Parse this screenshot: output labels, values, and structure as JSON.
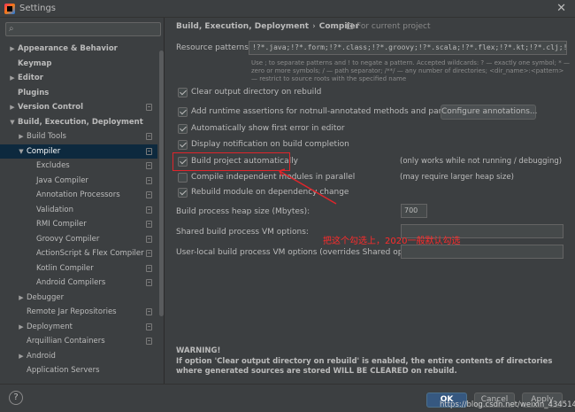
{
  "window": {
    "title": "Settings"
  },
  "search": {
    "placeholder": ""
  },
  "tree": [
    {
      "label": "Appearance & Behavior",
      "bold": true,
      "arrow": "right",
      "indent": 0
    },
    {
      "label": "Keymap",
      "bold": true,
      "arrow": "",
      "indent": 0
    },
    {
      "label": "Editor",
      "bold": true,
      "arrow": "right",
      "indent": 0
    },
    {
      "label": "Plugins",
      "bold": true,
      "arrow": "",
      "indent": 0
    },
    {
      "label": "Version Control",
      "bold": true,
      "arrow": "right",
      "indent": 0,
      "cfg": true
    },
    {
      "label": "Build, Execution, Deployment",
      "bold": true,
      "arrow": "down",
      "indent": 0
    },
    {
      "label": "Build Tools",
      "bold": false,
      "arrow": "right",
      "indent": 1,
      "cfg": true
    },
    {
      "label": "Compiler",
      "bold": false,
      "arrow": "down",
      "indent": 1,
      "cfg": true,
      "selected": true
    },
    {
      "label": "Excludes",
      "bold": false,
      "arrow": "",
      "indent": 2,
      "cfg": true
    },
    {
      "label": "Java Compiler",
      "bold": false,
      "arrow": "",
      "indent": 2,
      "cfg": true
    },
    {
      "label": "Annotation Processors",
      "bold": false,
      "arrow": "",
      "indent": 2,
      "cfg": true
    },
    {
      "label": "Validation",
      "bold": false,
      "arrow": "",
      "indent": 2,
      "cfg": true
    },
    {
      "label": "RMI Compiler",
      "bold": false,
      "arrow": "",
      "indent": 2,
      "cfg": true
    },
    {
      "label": "Groovy Compiler",
      "bold": false,
      "arrow": "",
      "indent": 2,
      "cfg": true
    },
    {
      "label": "ActionScript & Flex Compiler",
      "bold": false,
      "arrow": "",
      "indent": 2,
      "cfg": true
    },
    {
      "label": "Kotlin Compiler",
      "bold": false,
      "arrow": "",
      "indent": 2,
      "cfg": true
    },
    {
      "label": "Android Compilers",
      "bold": false,
      "arrow": "",
      "indent": 2,
      "cfg": true
    },
    {
      "label": "Debugger",
      "bold": false,
      "arrow": "right",
      "indent": 1
    },
    {
      "label": "Remote Jar Repositories",
      "bold": false,
      "arrow": "",
      "indent": 1,
      "cfg": true
    },
    {
      "label": "Deployment",
      "bold": false,
      "arrow": "right",
      "indent": 1,
      "cfg": true
    },
    {
      "label": "Arquillian Containers",
      "bold": false,
      "arrow": "",
      "indent": 1,
      "cfg": true
    },
    {
      "label": "Android",
      "bold": false,
      "arrow": "right",
      "indent": 1
    },
    {
      "label": "Application Servers",
      "bold": false,
      "arrow": "",
      "indent": 1
    }
  ],
  "breadcrumb": {
    "parent": "Build, Execution, Deployment",
    "separator": "›",
    "current": "Compiler",
    "scope": "For current project"
  },
  "resource_patterns": {
    "label": "Resource patterns:",
    "value": "!?*.java;!?*.form;!?*.class;!?*.groovy;!?*.scala;!?*.flex;!?*.kt;!?*.clj;!?*.aj",
    "hint": "Use ; to separate patterns and ! to negate a pattern. Accepted wildcards: ? — exactly one symbol; * — zero or more symbols; / — path separator; /**/ — any number of directories; <dir_name>:<pattern> — restrict to source roots with the specified name"
  },
  "options": {
    "clear_output": {
      "label": "Clear output directory on rebuild",
      "checked": true
    },
    "runtime_assertions": {
      "label": "Add runtime assertions for notnull-annotated methods and parameters",
      "checked": true
    },
    "configure_annotations": "Configure annotations...",
    "show_first_error": {
      "label": "Automatically show first error in editor",
      "checked": true
    },
    "display_notification": {
      "label": "Display notification on build completion",
      "checked": true
    },
    "build_automatically": {
      "label": "Build project automatically",
      "checked": true,
      "note": "(only works while not running / debugging)"
    },
    "compile_parallel": {
      "label": "Compile independent modules in parallel",
      "checked": false,
      "note": "(may require larger heap size)"
    },
    "rebuild_on_change": {
      "label": "Rebuild module on dependency change",
      "checked": true
    }
  },
  "heap": {
    "label": "Build process heap size (Mbytes):",
    "value": "700"
  },
  "shared_vm": {
    "label": "Shared build process VM options:",
    "value": ""
  },
  "user_vm": {
    "label": "User-local build process VM options (overrides Shared options):",
    "value": ""
  },
  "annotation": {
    "text": "把这个勾选上，2020一般默认勾选",
    "color": "#ff2b2b"
  },
  "warning": {
    "title": "WARNING!",
    "text": "If option 'Clear output directory on rebuild' is enabled, the entire contents of directories where generated sources are stored WILL BE CLEARED on rebuild."
  },
  "footer": {
    "help": "?",
    "ok": "OK",
    "cancel": "Cancel",
    "apply": "Apply"
  },
  "watermark": "https://blog.csdn.net/weixin_43451430"
}
